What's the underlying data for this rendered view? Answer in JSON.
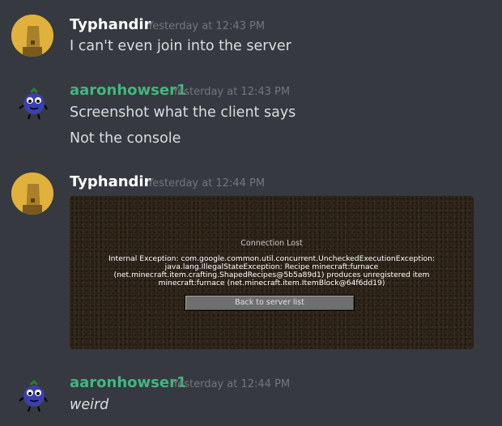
{
  "colors": {
    "background": "#36393f",
    "typhandir_name": "#ffffff",
    "aaron_name": "#43b581",
    "timestamp": "#72767d",
    "text": "#dcddde"
  },
  "messages": [
    {
      "author": "Typhandir",
      "timestamp": "Yesterday at 12:43 PM",
      "lines": [
        "I can't even join into the server"
      ]
    },
    {
      "author": "aaronhowser1",
      "timestamp": "Yesterday at 12:43 PM",
      "lines": [
        "Screenshot what the client says",
        "Not the console"
      ]
    },
    {
      "author": "Typhandir",
      "timestamp": "Yesterday at 12:44 PM",
      "attachment": {
        "title": "Connection Lost",
        "lines": [
          "Internal Exception: com.google.common.util.concurrent.UncheckedExecutionException:",
          "java.lang.IllegalStateException: Recipe minecraft:furnace",
          "(net.minecraft.item.crafting.ShapedRecipes@5b5a89d1) produces unregistered item",
          "minecraft:furnace (net.minecraft.item.ItemBlock@64f6dd19)"
        ],
        "button": "Back to server list"
      }
    },
    {
      "author": "aaronhowser1",
      "timestamp": "Yesterday at 12:44 PM",
      "lines": [
        "weird"
      ]
    }
  ]
}
